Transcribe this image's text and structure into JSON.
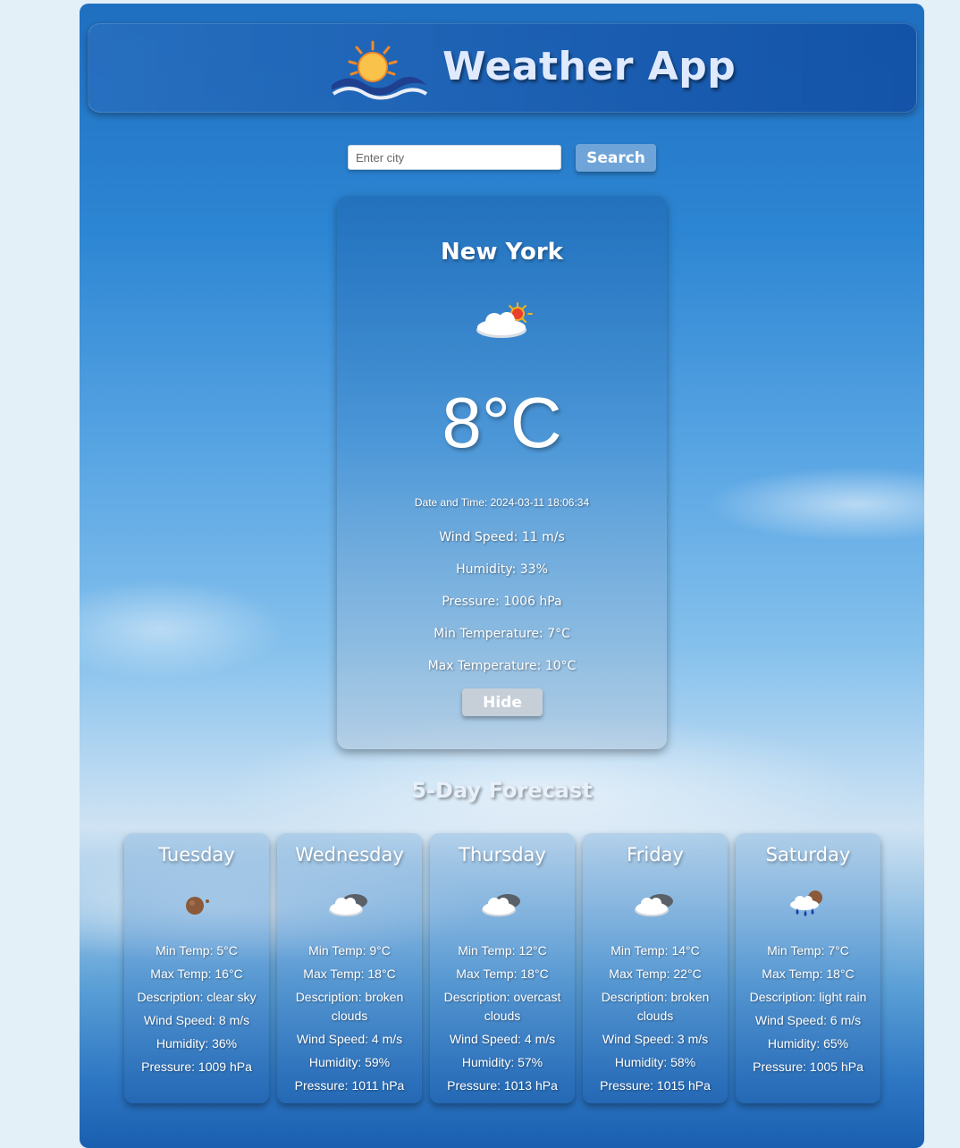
{
  "header": {
    "title": "Weather App",
    "logo_icon": "sun-over-waves-logo"
  },
  "search": {
    "placeholder": "Enter city",
    "value": "",
    "button_label": "Search"
  },
  "current": {
    "city": "New York",
    "icon": "few-clouds-day-icon",
    "temperature": "8°C",
    "datetime": "Date and Time: 2024-03-11 18:06:34",
    "wind_speed": "Wind Speed: 11 m/s",
    "humidity": "Humidity: 33%",
    "pressure": "Pressure: 1006 hPa",
    "min_temp": "Min Temperature: 7°C",
    "max_temp": "Max Temperature: 10°C",
    "hide_label": "Hide"
  },
  "forecast": {
    "title": "5-Day Forecast",
    "days": [
      {
        "day": "Tuesday",
        "icon": "clear-sky-night-icon",
        "min": "Min Temp: 5°C",
        "max": "Max Temp: 16°C",
        "description": "Description: clear sky",
        "wind": "Wind Speed: 8 m/s",
        "humidity": "Humidity: 36%",
        "pressure": "Pressure: 1009 hPa"
      },
      {
        "day": "Wednesday",
        "icon": "broken-clouds-icon",
        "min": "Min Temp: 9°C",
        "max": "Max Temp: 18°C",
        "description": "Description: broken clouds",
        "wind": "Wind Speed: 4 m/s",
        "humidity": "Humidity: 59%",
        "pressure": "Pressure: 1011 hPa"
      },
      {
        "day": "Thursday",
        "icon": "overcast-clouds-icon",
        "min": "Min Temp: 12°C",
        "max": "Max Temp: 18°C",
        "description": "Description: overcast clouds",
        "wind": "Wind Speed: 4 m/s",
        "humidity": "Humidity: 57%",
        "pressure": "Pressure: 1013 hPa"
      },
      {
        "day": "Friday",
        "icon": "broken-clouds-icon",
        "min": "Min Temp: 14°C",
        "max": "Max Temp: 22°C",
        "description": "Description: broken clouds",
        "wind": "Wind Speed: 3 m/s",
        "humidity": "Humidity: 58%",
        "pressure": "Pressure: 1015 hPa"
      },
      {
        "day": "Saturday",
        "icon": "light-rain-night-icon",
        "min": "Min Temp: 7°C",
        "max": "Max Temp: 18°C",
        "description": "Description: light rain",
        "wind": "Wind Speed: 6 m/s",
        "humidity": "Humidity: 65%",
        "pressure": "Pressure: 1005 hPa"
      }
    ]
  }
}
